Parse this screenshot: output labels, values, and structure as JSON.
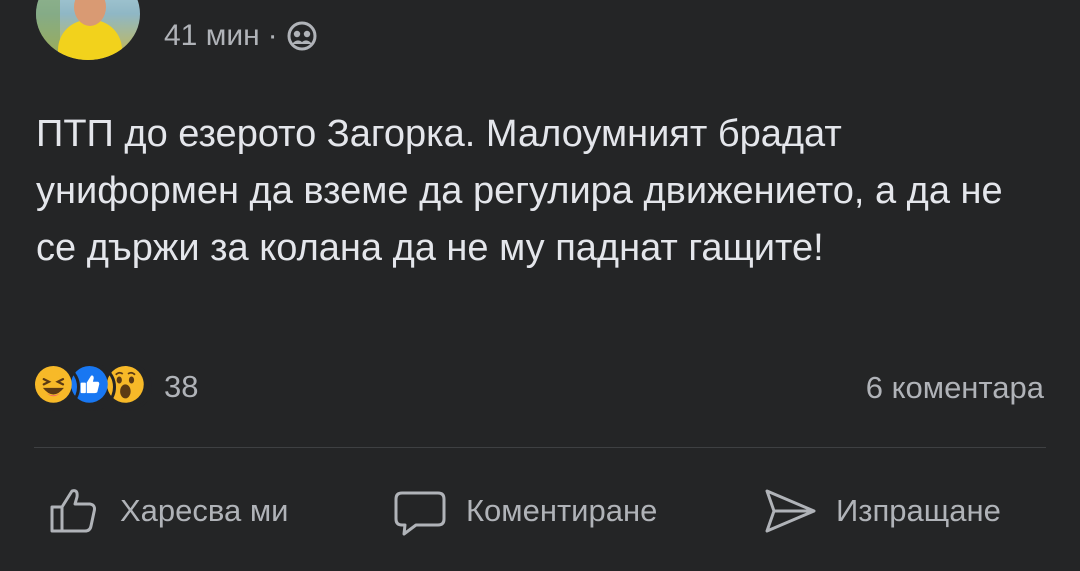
{
  "header": {
    "time": "41 мин",
    "separator": "·",
    "audience_icon": "friends-icon"
  },
  "post": {
    "text": "ПТП до езерото Загорка. Малоумният брадат униформен да вземе да регулира движението, а да не се държи за колана да не му паднат гащите!"
  },
  "stats": {
    "reactions": [
      "haha-icon",
      "like-icon",
      "wow-icon"
    ],
    "reaction_count": "38",
    "comments": "6 коментара"
  },
  "actions": {
    "like_label": "Харесва ми",
    "comment_label": "Коментиране",
    "share_label": "Изпращане"
  },
  "colors": {
    "background": "#242526",
    "text": "#e4e6eb",
    "secondary_text": "#b0b3b8",
    "like_blue": "#1877f2",
    "reaction_yellow": "#f7b928"
  }
}
